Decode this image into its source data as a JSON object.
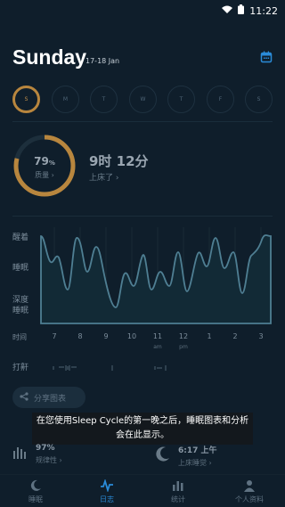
{
  "status_bar": {
    "time": "11:22"
  },
  "header": {
    "title": "Sunday",
    "date_range": "17-18 Jan"
  },
  "week": {
    "days": [
      "S",
      "M",
      "T",
      "W",
      "T",
      "F",
      "S"
    ],
    "active_index": 0
  },
  "summary": {
    "quality_value": "79",
    "quality_unit": "%",
    "quality_label": "质量 ›",
    "quality_fraction": 0.79,
    "duration": "9时 12分",
    "bed_label": "上床了 ›"
  },
  "graph": {
    "y_labels": {
      "awake": "醒着",
      "sleep": "睡眠",
      "deep": "深度\n睡眠"
    },
    "x_label": "时间",
    "x_ticks": [
      "7",
      "8",
      "9",
      "10",
      "11",
      "12",
      "1",
      "2",
      "3"
    ],
    "x_sub": {
      "am": "am",
      "pm": "pm"
    },
    "snore_label": "打鼾"
  },
  "share_label": "分享图表",
  "toast": "在您使用Sleep Cycle的第一晚之后，睡眠图表和分析会在此显示。",
  "stats": [
    {
      "value": "97%",
      "label": "规律性 ›"
    },
    {
      "value": "6:17 上午",
      "label": "上床睡觉 ›"
    }
  ],
  "tabs": [
    {
      "label": "睡眠",
      "icon": "moon-icon",
      "active": false
    },
    {
      "label": "日志",
      "icon": "pulse-icon",
      "active": true
    },
    {
      "label": "统计",
      "icon": "bar-chart-icon",
      "active": false
    },
    {
      "label": "个人资料",
      "icon": "person-icon",
      "active": false
    }
  ],
  "colors": {
    "accent": "#2a8bd8",
    "quality": "#b8863e",
    "graph": "#4f7f93",
    "background": "#0f1e2b"
  }
}
